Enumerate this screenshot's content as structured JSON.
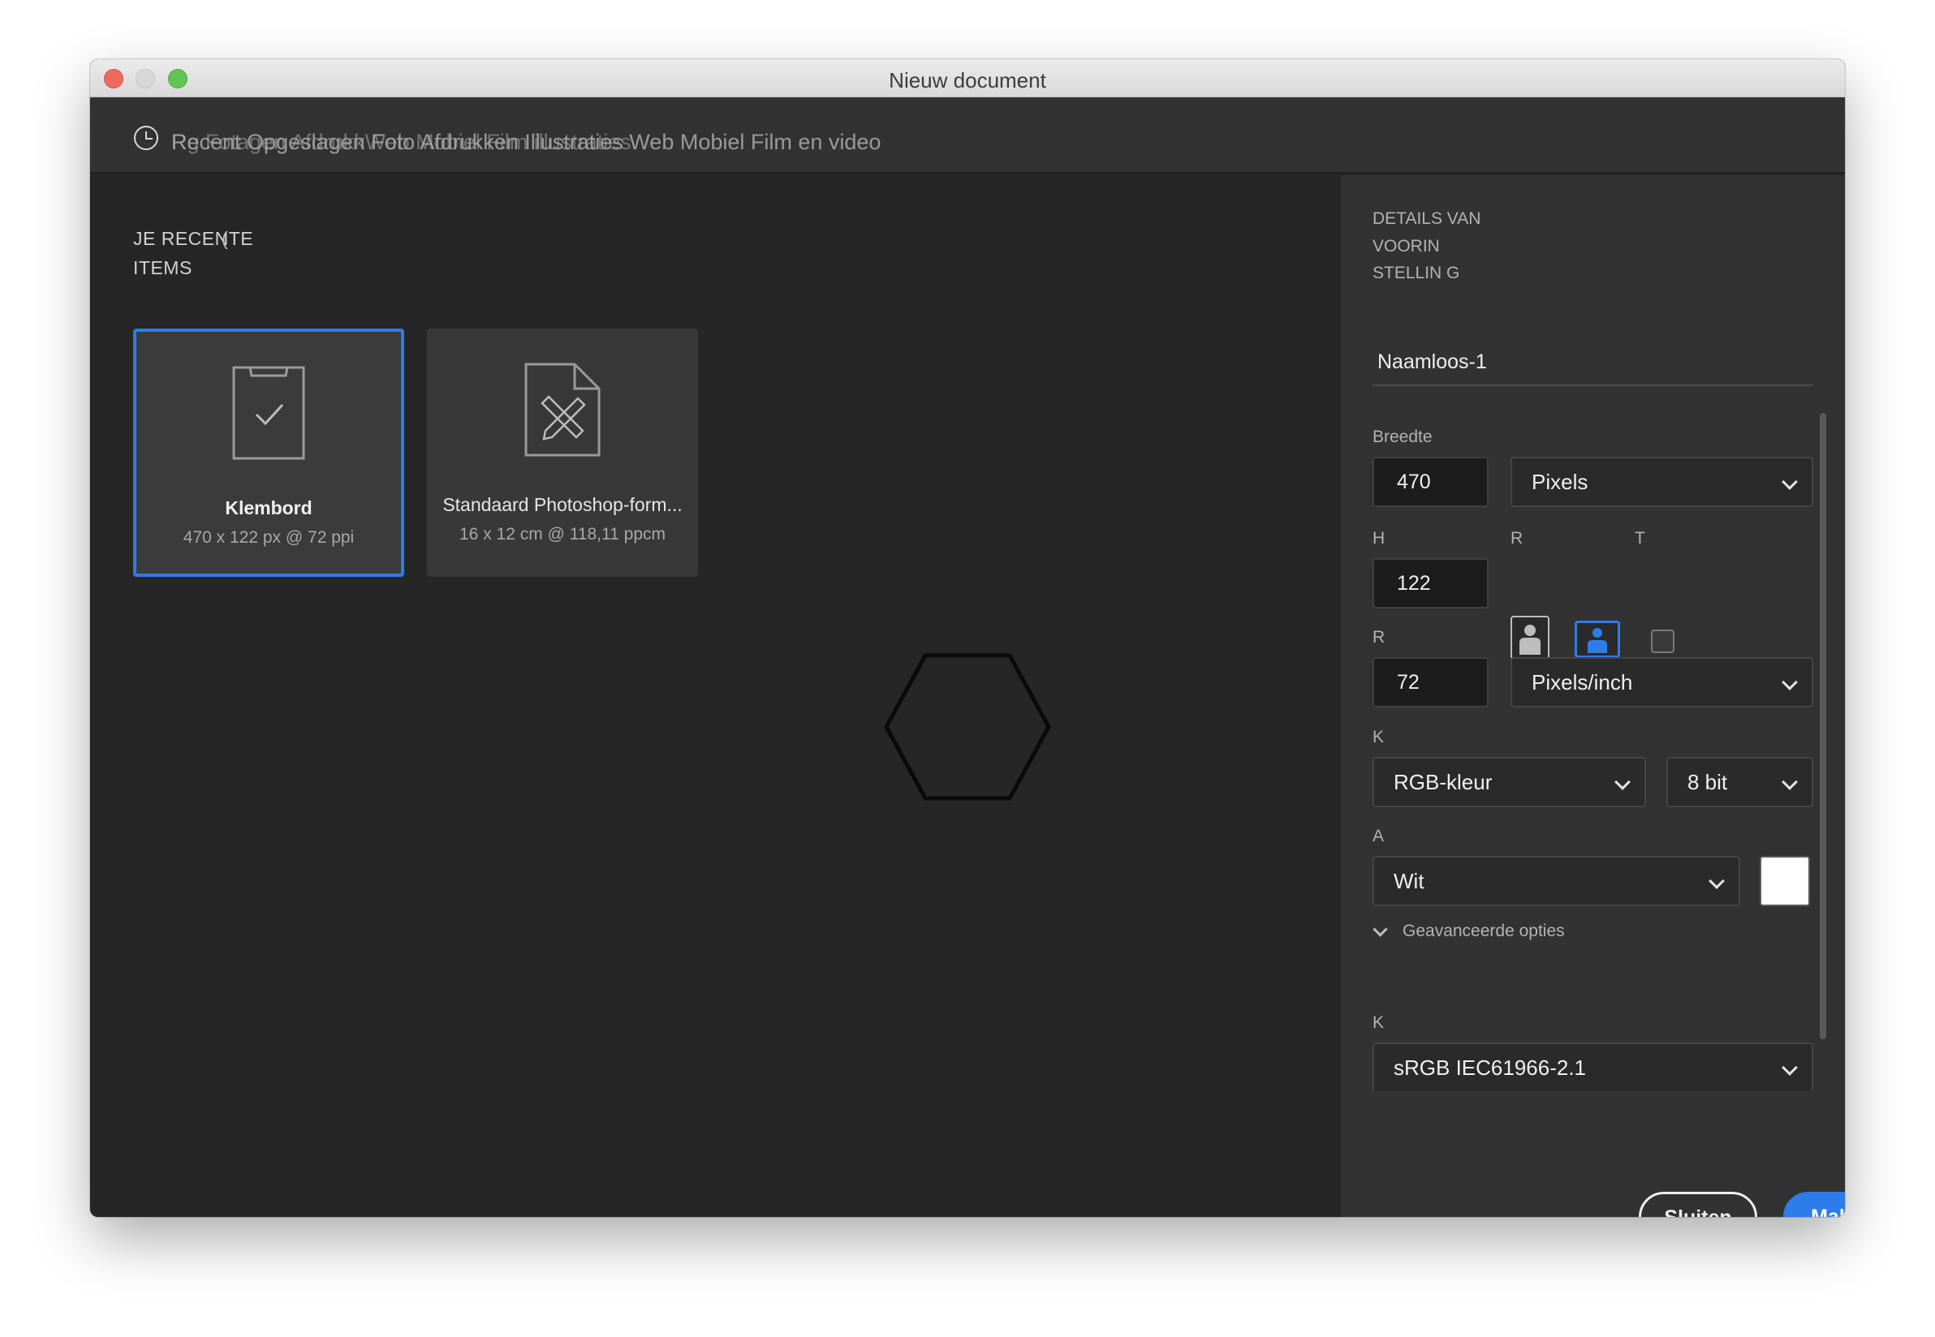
{
  "window": {
    "title": "Nieuw document"
  },
  "tabs": {
    "label": "Recent Opgeslagen Foto Afdrukken Illustraties Web Mobiel Film en video",
    "label_overlay": "Rg Fotagen AfdrukkWeb Mobiel Film illustraties"
  },
  "recent": {
    "title": "JE RECENTE ITEMS",
    "paren": "("
  },
  "cards": [
    {
      "name": "Klembord",
      "info": "470 x 122 px @ 72 ppi",
      "icon": "clipboard-icon"
    },
    {
      "name": "Standaard Photoshop-form...",
      "info": "16 x 12 cm @ 118,11 ppcm",
      "icon": "document-ruler-pencil-icon"
    }
  ],
  "sidebar": {
    "heading": "DETAILS VAN VOORIN STELLIN G",
    "doc_name": "Naamloos-1",
    "width_label": "Breedte",
    "width_value": "470",
    "width_unit": "Pixels",
    "height_label": "H",
    "height_value": "122",
    "orientation_label": "R",
    "artboard_label": "T",
    "resolution_label": "R",
    "resolution_value": "72",
    "resolution_unit": "Pixels/inch",
    "color_label": "K",
    "color_mode": "RGB-kleur",
    "bit_depth": "8 bit",
    "background_label": "A",
    "background_value": "Wit",
    "background_color": "#ffffff",
    "advanced_label": "Geavanceerde opties",
    "profile_label": "K",
    "profile_value": "sRGB IEC61966-2.1",
    "close_button": "Sluiten",
    "create_button": "Maken"
  },
  "colors": {
    "accent": "#2c7dea",
    "panel": "#323232",
    "main": "#262626"
  }
}
